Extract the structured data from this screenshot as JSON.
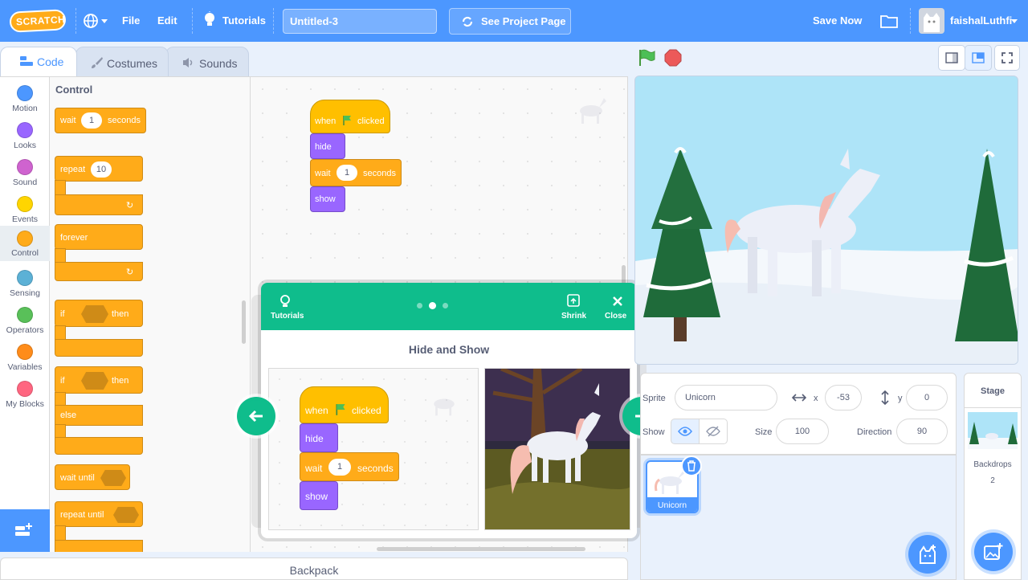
{
  "menu": {
    "logo": "SCRATCH",
    "file": "File",
    "edit": "Edit",
    "tutorials": "Tutorials",
    "project_title": "Untitled-3",
    "see_project": "See Project Page",
    "save_now": "Save Now",
    "username": "faishalLuthfi"
  },
  "tabs": {
    "code": "Code",
    "costumes": "Costumes",
    "sounds": "Sounds"
  },
  "categories": [
    {
      "label": "Motion",
      "color": "#4c97ff"
    },
    {
      "label": "Looks",
      "color": "#9966ff"
    },
    {
      "label": "Sound",
      "color": "#cf63cf"
    },
    {
      "label": "Events",
      "color": "#ffd500"
    },
    {
      "label": "Control",
      "color": "#ffab19"
    },
    {
      "label": "Sensing",
      "color": "#5cb1d6"
    },
    {
      "label": "Operators",
      "color": "#59c059"
    },
    {
      "label": "Variables",
      "color": "#ff8c1a"
    },
    {
      "label": "My Blocks",
      "color": "#ff6680"
    }
  ],
  "palette": {
    "heading": "Control",
    "wait": "wait",
    "wait_value": "1",
    "seconds": "seconds",
    "repeat": "repeat",
    "repeat_value": "10",
    "forever": "forever",
    "if": "if",
    "then": "then",
    "else": "else",
    "wait_until": "wait until",
    "repeat_until": "repeat until"
  },
  "script": {
    "when": "when",
    "clicked": "clicked",
    "hide": "hide",
    "wait": "wait",
    "wait_value": "1",
    "seconds": "seconds",
    "show": "show"
  },
  "tutorial": {
    "label": "Tutorials",
    "shrink": "Shrink",
    "close": "Close",
    "title": "Hide and Show",
    "when": "when",
    "clicked": "clicked",
    "hide": "hide",
    "wait": "wait",
    "wait_value": "1",
    "seconds": "seconds",
    "show": "show"
  },
  "sprite_info": {
    "sprite_label": "Sprite",
    "sprite_name": "Unicorn",
    "x_label": "x",
    "x_value": "-53",
    "y_label": "y",
    "y_value": "0",
    "show_label": "Show",
    "size_label": "Size",
    "size_value": "100",
    "direction_label": "Direction",
    "direction_value": "90"
  },
  "sprites": [
    {
      "name": "Unicorn"
    }
  ],
  "stage_panel": {
    "title": "Stage",
    "backdrops_label": "Backdrops",
    "backdrops_count": "2"
  },
  "backpack": "Backpack",
  "colors": {
    "menu_blue": "#4c97ff",
    "control": "#ffab19",
    "looks": "#9966ff",
    "tutorial_green": "#0fbd8c"
  }
}
